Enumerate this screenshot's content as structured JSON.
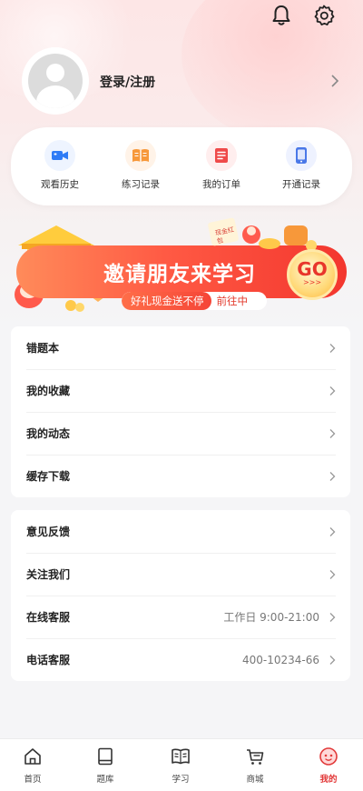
{
  "header": {
    "notification_icon": "bell-icon",
    "settings_icon": "gear-icon"
  },
  "user": {
    "login_label": "登录/注册",
    "avatar_icon": "default-avatar-icon"
  },
  "quick_actions": [
    {
      "label": "观看历史",
      "icon": "video-icon",
      "color": "#2f7cf6",
      "bg": "#eef4ff"
    },
    {
      "label": "练习记录",
      "icon": "book-open-icon",
      "color": "#f7983a",
      "bg": "#fff3e8"
    },
    {
      "label": "我的订单",
      "icon": "order-list-icon",
      "color": "#ef4a4a",
      "bg": "#ffeeee"
    },
    {
      "label": "开通记录",
      "icon": "phone-icon",
      "color": "#4a78e8",
      "bg": "#eef2ff"
    }
  ],
  "banner": {
    "title": "邀请朋友来学习",
    "subtitle_left": "好礼现金送不停",
    "subtitle_right": "前往中",
    "go_label": "GO",
    "go_arrows": ">>>",
    "tag_text": "现金红包"
  },
  "menu_group_1": [
    {
      "label": "错题本",
      "value": ""
    },
    {
      "label": "我的收藏",
      "value": ""
    },
    {
      "label": "我的动态",
      "value": ""
    },
    {
      "label": "缓存下载",
      "value": ""
    }
  ],
  "menu_group_2": [
    {
      "label": "意见反馈",
      "value": ""
    },
    {
      "label": "关注我们",
      "value": ""
    },
    {
      "label": "在线客服",
      "value": "工作日 9:00-21:00"
    },
    {
      "label": "电话客服",
      "value": "400-10234-66"
    }
  ],
  "tabbar": [
    {
      "label": "首页",
      "icon": "home-icon",
      "active": false
    },
    {
      "label": "题库",
      "icon": "question-bank-icon",
      "active": false
    },
    {
      "label": "学习",
      "icon": "study-book-icon",
      "active": false
    },
    {
      "label": "商城",
      "icon": "shopping-cart-icon",
      "active": false
    },
    {
      "label": "我的",
      "icon": "profile-face-icon",
      "active": true
    }
  ],
  "colors": {
    "accent": "#e23a3a",
    "banner_start": "#ff8b5a",
    "banner_end": "#f3362e"
  }
}
